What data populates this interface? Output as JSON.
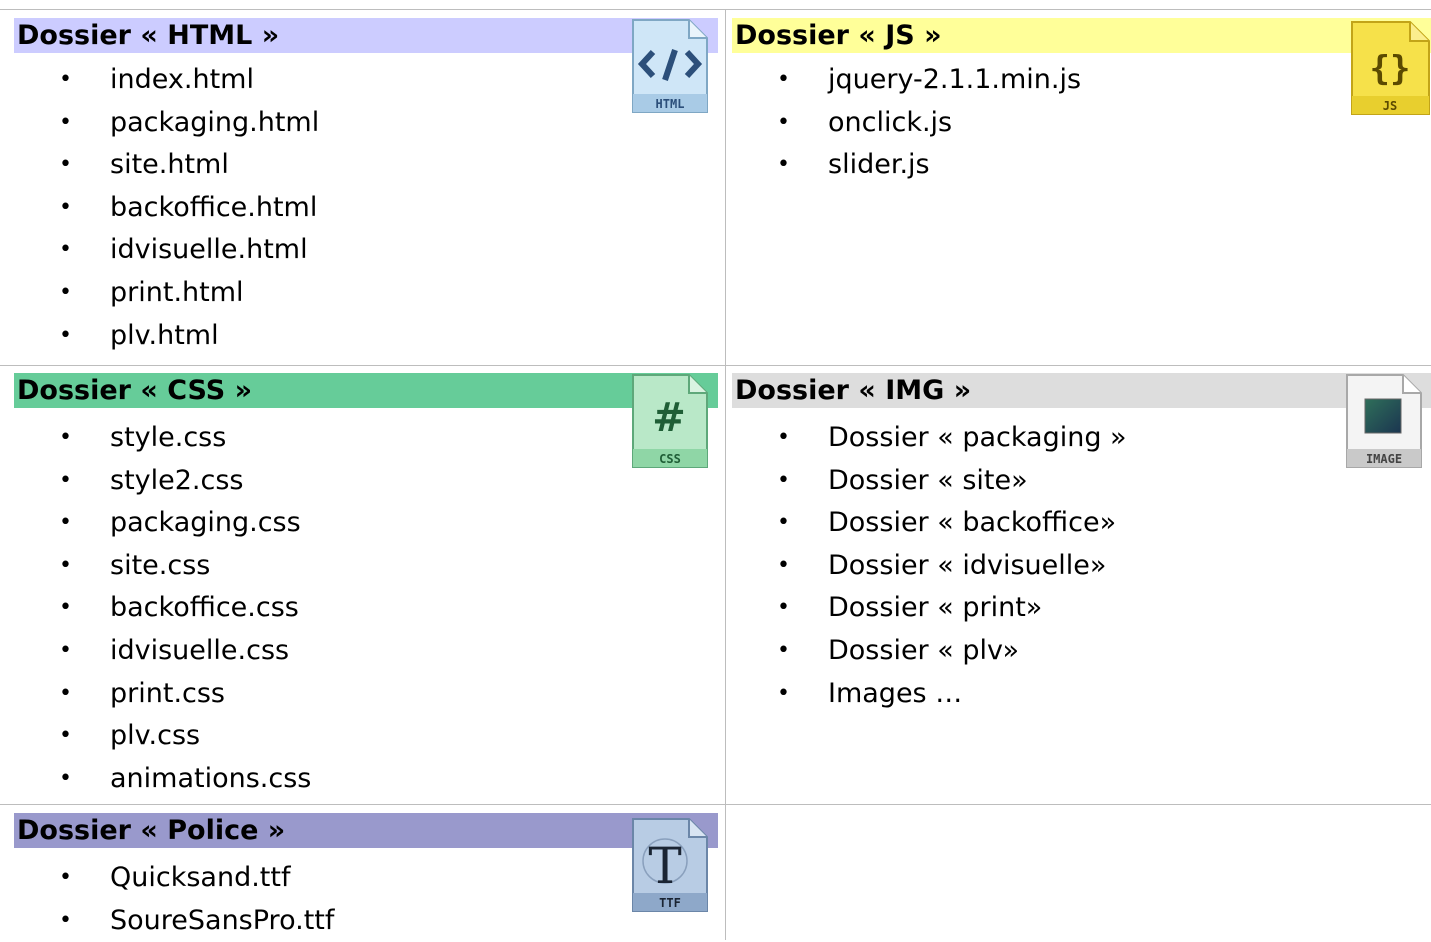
{
  "folders": {
    "html": {
      "title": "Dossier « HTML »",
      "color": "#ccccff",
      "icon": "html-file-icon",
      "icon_label": "HTML",
      "items": [
        "index.html",
        "packaging.html",
        "site.html",
        "backoffice.html",
        "idvisuelle.html",
        "print.html",
        "plv.html"
      ]
    },
    "js": {
      "title": "Dossier « JS »",
      "color": "#ffff99",
      "icon": "js-file-icon",
      "icon_label": "JS",
      "items": [
        "jquery-2.1.1.min.js",
        "onclick.js",
        "slider.js"
      ]
    },
    "css": {
      "title": "Dossier « CSS »",
      "color": "#66cc99",
      "icon": "css-file-icon",
      "icon_label": "CSS",
      "items": [
        "style.css",
        "style2.css",
        "packaging.css",
        "site.css",
        "backoffice.css",
        "idvisuelle.css",
        "print.css",
        "plv.css",
        "animations.css"
      ]
    },
    "img": {
      "title": "Dossier « IMG »",
      "color": "#dddddd",
      "icon": "image-file-icon",
      "icon_label": "IMAGE",
      "items": [
        "Dossier « packaging »",
        "Dossier « site»",
        "Dossier « backoffice»",
        "Dossier « idvisuelle»",
        "Dossier « print»",
        "Dossier « plv»",
        "Images …"
      ]
    },
    "police": {
      "title": "Dossier « Police »",
      "color": "#9999cc",
      "icon": "ttf-font-file-icon",
      "icon_label": "TTF",
      "items": [
        "Quicksand.ttf",
        "SoureSansPro.ttf"
      ]
    }
  }
}
